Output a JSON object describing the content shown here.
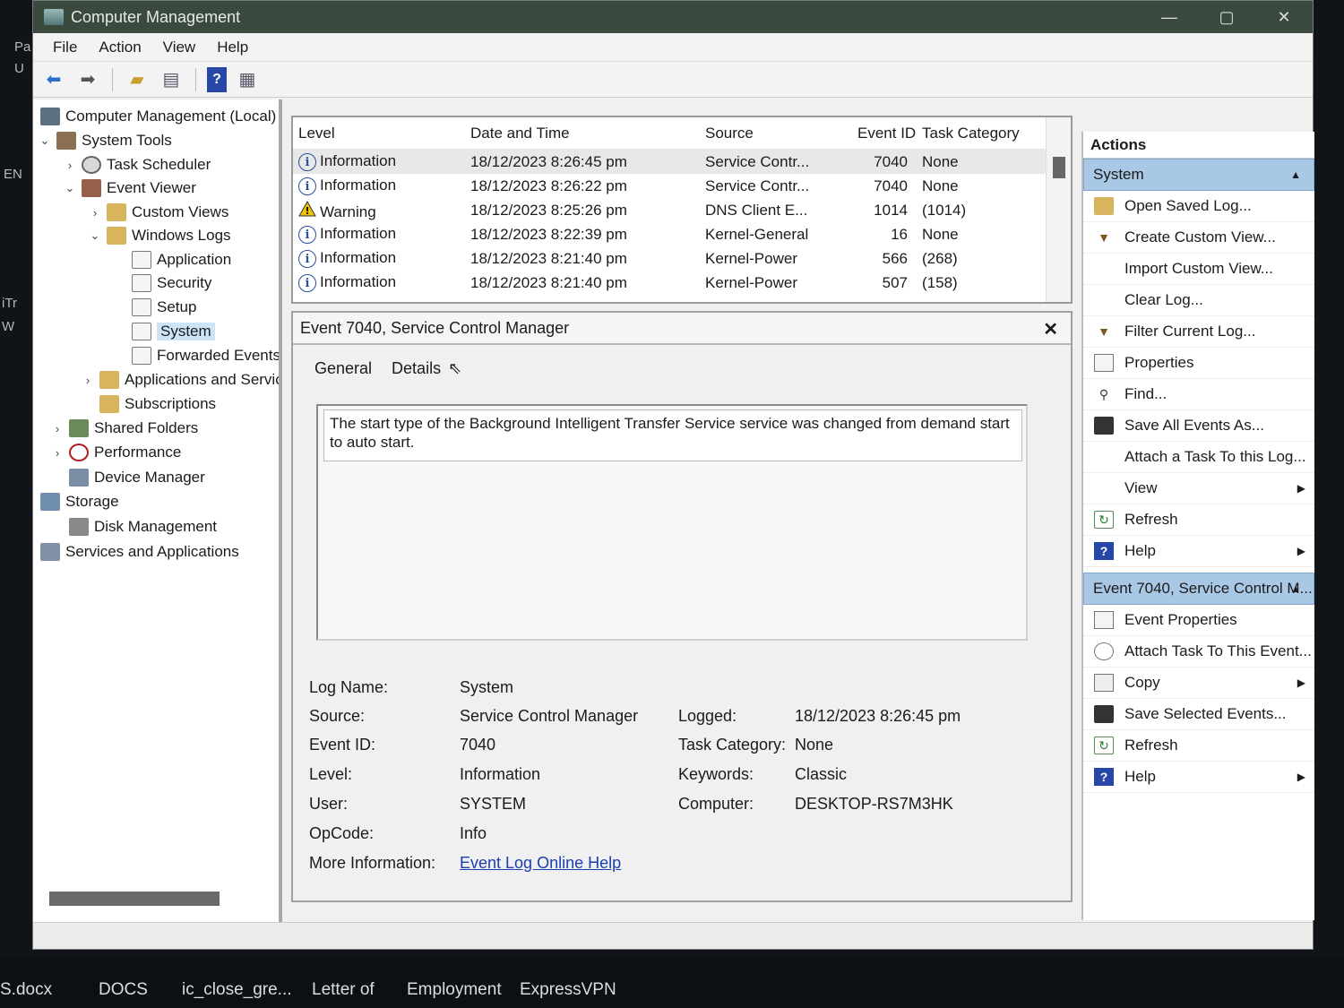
{
  "window": {
    "title": "Computer Management",
    "controls": {
      "minimize": "—",
      "maximize": "▢",
      "close": "✕"
    }
  },
  "menu": [
    "File",
    "Action",
    "View",
    "Help"
  ],
  "tree": [
    {
      "label": "Computer Management (Local)",
      "icon": "computer-icon",
      "chevron": ""
    },
    {
      "label": "System Tools",
      "icon": "tools-icon",
      "chevron": "⌄"
    },
    {
      "label": "Task Scheduler",
      "icon": "clock-icon",
      "chevron": "›"
    },
    {
      "label": "Event Viewer",
      "icon": "event-viewer-icon",
      "chevron": "⌄"
    },
    {
      "label": "Custom Views",
      "icon": "folder-icon",
      "chevron": "›"
    },
    {
      "label": "Windows Logs",
      "icon": "folder-icon",
      "chevron": "⌄"
    },
    {
      "label": "Application",
      "icon": "log-icon",
      "chevron": ""
    },
    {
      "label": "Security",
      "icon": "log-icon",
      "chevron": ""
    },
    {
      "label": "Setup",
      "icon": "log-icon",
      "chevron": ""
    },
    {
      "label": "System",
      "icon": "log-icon",
      "chevron": ""
    },
    {
      "label": "Forwarded Events",
      "icon": "log-icon",
      "chevron": ""
    },
    {
      "label": "Applications and Services Logs",
      "icon": "folder-icon",
      "chevron": "›"
    },
    {
      "label": "Subscriptions",
      "icon": "folder-icon",
      "chevron": ""
    },
    {
      "label": "Shared Folders",
      "icon": "share-icon",
      "chevron": "›"
    },
    {
      "label": "Performance",
      "icon": "performance-icon",
      "chevron": "›"
    },
    {
      "label": "Device Manager",
      "icon": "device-icon",
      "chevron": ""
    },
    {
      "label": "Storage",
      "icon": "storage-icon",
      "chevron": "⌄"
    },
    {
      "label": "Disk Management",
      "icon": "disk-icon",
      "chevron": ""
    },
    {
      "label": "Services and Applications",
      "icon": "services-icon",
      "chevron": "›"
    }
  ],
  "events": {
    "columns": [
      "Level",
      "Date and Time",
      "Source",
      "Event ID",
      "Task Category"
    ],
    "rows": [
      {
        "level": "Information",
        "date": "18/12/2023 8:26:45 pm",
        "source": "Service Contr...",
        "id": "7040",
        "category": "None"
      },
      {
        "level": "Information",
        "date": "18/12/2023 8:26:22 pm",
        "source": "Service Contr...",
        "id": "7040",
        "category": "None"
      },
      {
        "level": "Warning",
        "date": "18/12/2023 8:25:26 pm",
        "source": "DNS Client E...",
        "id": "1014",
        "category": "(1014)"
      },
      {
        "level": "Information",
        "date": "18/12/2023 8:22:39 pm",
        "source": "Kernel-General",
        "id": "16",
        "category": "None"
      },
      {
        "level": "Information",
        "date": "18/12/2023 8:21:40 pm",
        "source": "Kernel-Power",
        "id": "566",
        "category": "(268)"
      },
      {
        "level": "Information",
        "date": "18/12/2023 8:21:40 pm",
        "source": "Kernel-Power",
        "id": "507",
        "category": "(158)"
      }
    ]
  },
  "detail": {
    "title": "Event 7040, Service Control Manager",
    "tabs": [
      "General",
      "Details"
    ],
    "description": "The start type of the Background Intelligent Transfer Service service was changed from demand start to auto start.",
    "labels": {
      "log_name": "Log Name:",
      "source": "Source:",
      "event_id": "Event ID:",
      "level": "Level:",
      "user": "User:",
      "opcode": "OpCode:",
      "more_info": "More Information:",
      "logged": "Logged:",
      "task_category": "Task Category:",
      "keywords": "Keywords:",
      "computer": "Computer:"
    },
    "values": {
      "log_name": "System",
      "source": "Service Control Manager",
      "event_id": "7040",
      "level": "Information",
      "user": "SYSTEM",
      "opcode": "Info",
      "more_info": "Event Log Online Help",
      "logged": "18/12/2023 8:26:45 pm",
      "task_category": "None",
      "keywords": "Classic",
      "computer": "DESKTOP-RS7M3HK"
    }
  },
  "actions": {
    "header": "Actions",
    "group1": "System",
    "items1": [
      {
        "label": "Open Saved Log...",
        "icon": "open-log-icon",
        "arrow": ""
      },
      {
        "label": "Create Custom View...",
        "icon": "filter-icon",
        "arrow": ""
      },
      {
        "label": "Import Custom View...",
        "icon": "",
        "arrow": ""
      },
      {
        "label": "Clear Log...",
        "icon": "",
        "arrow": ""
      },
      {
        "label": "Filter Current Log...",
        "icon": "filter-icon",
        "arrow": ""
      },
      {
        "label": "Properties",
        "icon": "properties-icon",
        "arrow": ""
      },
      {
        "label": "Find...",
        "icon": "find-icon",
        "arrow": ""
      },
      {
        "label": "Save All Events As...",
        "icon": "save-icon",
        "arrow": ""
      },
      {
        "label": "Attach a Task To this Log...",
        "icon": "",
        "arrow": ""
      },
      {
        "label": "View",
        "icon": "",
        "arrow": "▶"
      },
      {
        "label": "Refresh",
        "icon": "refresh-icon",
        "arrow": ""
      },
      {
        "label": "Help",
        "icon": "help-icon",
        "arrow": "▶"
      }
    ],
    "group2": "Event 7040, Service Control M...",
    "items2": [
      {
        "label": "Event Properties",
        "icon": "properties-icon",
        "arrow": ""
      },
      {
        "label": "Attach Task To This Event...",
        "icon": "task-icon",
        "arrow": ""
      },
      {
        "label": "Copy",
        "icon": "copy-icon",
        "arrow": "▶"
      },
      {
        "label": "Save Selected Events...",
        "icon": "save-icon",
        "arrow": ""
      },
      {
        "label": "Refresh",
        "icon": "refresh-icon",
        "arrow": ""
      },
      {
        "label": "Help",
        "icon": "help-icon",
        "arrow": "▶"
      }
    ]
  },
  "taskbar": [
    "S.docx",
    "DOCS",
    "ic_close_gre...",
    "Letter of",
    "Employment",
    "ExpressVPN"
  ],
  "edge_text": [
    "Pa",
    "U",
    "EN",
    "iTr",
    "W"
  ]
}
